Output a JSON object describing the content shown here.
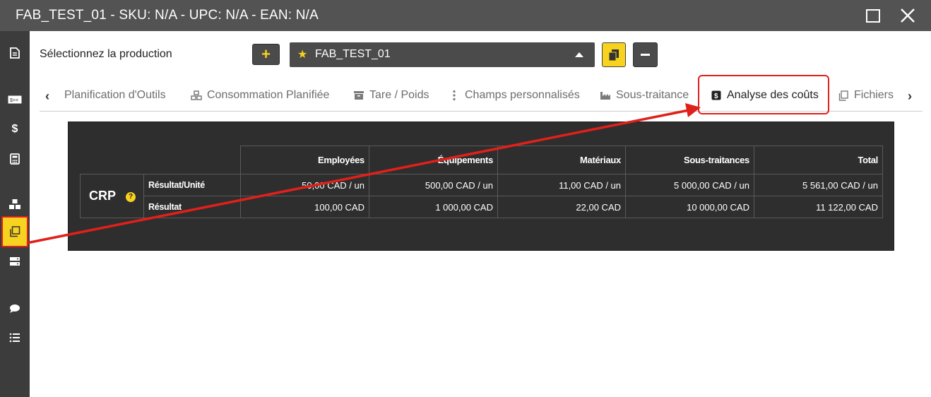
{
  "window": {
    "title": "FAB_TEST_01 - SKU: N/A - UPC: N/A - EAN: N/A"
  },
  "sidebar": {
    "icons": [
      "document-icon",
      "ticket-icon",
      "dollar-icon",
      "calculator-icon",
      "cubes-icon",
      "copy-icon",
      "server-icon",
      "comment-icon",
      "list-icon"
    ],
    "active": "copy-icon"
  },
  "production": {
    "label": "Sélectionnez la production",
    "add_label": "+",
    "selected": "FAB_TEST_01"
  },
  "tabs": {
    "items": [
      {
        "label": "Planification d'Outils",
        "icon": ""
      },
      {
        "label": "Consommation Planifiée",
        "icon": "cubes-icon"
      },
      {
        "label": "Tare / Poids",
        "icon": "archive-icon"
      },
      {
        "label": "Champs personnalisés",
        "icon": "ellipsis-vertical-icon"
      },
      {
        "label": "Sous-traitance",
        "icon": "industry-icon"
      },
      {
        "label": "Analyse des coûts",
        "icon": "dollar-square-icon"
      },
      {
        "label": "Fichiers",
        "icon": "copy-icon"
      }
    ],
    "active": "Analyse des coûts"
  },
  "cost_table": {
    "columns": [
      "Employées",
      "Équipements",
      "Matériaux",
      "Sous-traitances",
      "Total"
    ],
    "group_label": "CRP",
    "help": "?",
    "rows": [
      {
        "label": "Résultat/Unité",
        "values": [
          "50,00 CAD / un",
          "500,00 CAD / un",
          "11,00 CAD / un",
          "5 000,00 CAD / un",
          "5 561,00 CAD / un"
        ]
      },
      {
        "label": "Résultat",
        "values": [
          "100,00 CAD",
          "1 000,00 CAD",
          "22,00 CAD",
          "10 000,00 CAD",
          "11 122,00 CAD"
        ]
      }
    ]
  },
  "colors": {
    "accent": "#f7d21e",
    "annotation": "#e0201a",
    "titlebar": "#535353",
    "sidebar": "#3c3c3c",
    "panel": "#2e2e2e"
  }
}
